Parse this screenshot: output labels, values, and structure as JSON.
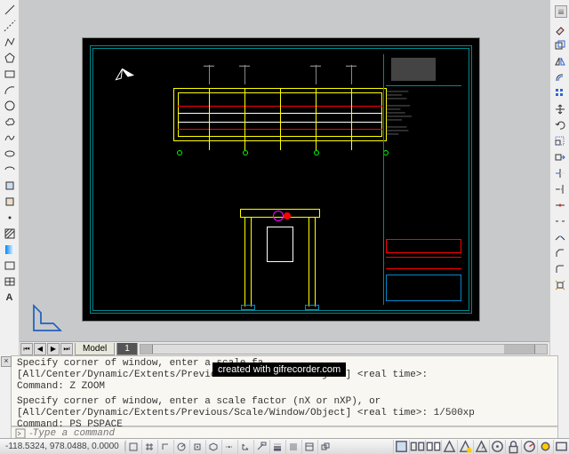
{
  "tabs": {
    "model": "Model",
    "layout1": "1"
  },
  "commandHistory": {
    "line1": "Specify corner of window, enter a scale fa",
    "line2": "[All/Center/Dynamic/Extents/Previous/Scale/Window/Object] <real time>:",
    "line3": "Command: Z ZOOM",
    "line4": "Specify corner of window, enter a scale factor (nX or nXP), or",
    "line5": "[All/Center/Dynamic/Extents/Previous/Scale/Window/Object] <real time>: 1/500xp",
    "line6": "Command: PS PSPACE"
  },
  "commandInput": {
    "placeholder": "Type a command"
  },
  "watermark": "created with gifrecorder.com",
  "status": {
    "coords": "-118.5324, 978.0488, 0.0000"
  },
  "leftTools": [
    "line",
    "polyline",
    "circle",
    "arc",
    "rectangle",
    "ellipse",
    "hatch",
    "spline",
    "xline",
    "point",
    "region",
    "table",
    "multiline",
    "divider",
    "move",
    "copy",
    "stretch",
    "rotate",
    "mirror",
    "scale",
    "trim",
    "text"
  ],
  "rightTools": [
    "handle",
    "distance",
    "window",
    "pan",
    "zoom-extents",
    "orbit",
    "arc-tool",
    "curve",
    "spline-r",
    "wave",
    "join",
    "offset",
    "tangent",
    "fillet",
    "chamfer",
    "rect",
    "align",
    "extend",
    "layers"
  ],
  "statusTools": [
    "snap",
    "grid",
    "ortho",
    "polar",
    "osnap",
    "3dosnap",
    "otrack",
    "ducs",
    "dyn",
    "lwt",
    "tpy",
    "qp",
    "sc",
    "am",
    "model",
    "qs",
    "a1",
    "a2",
    "a3",
    "a4",
    "a5",
    "a6",
    "a7",
    "a8",
    "a9",
    "a10",
    "a11",
    "a12"
  ]
}
